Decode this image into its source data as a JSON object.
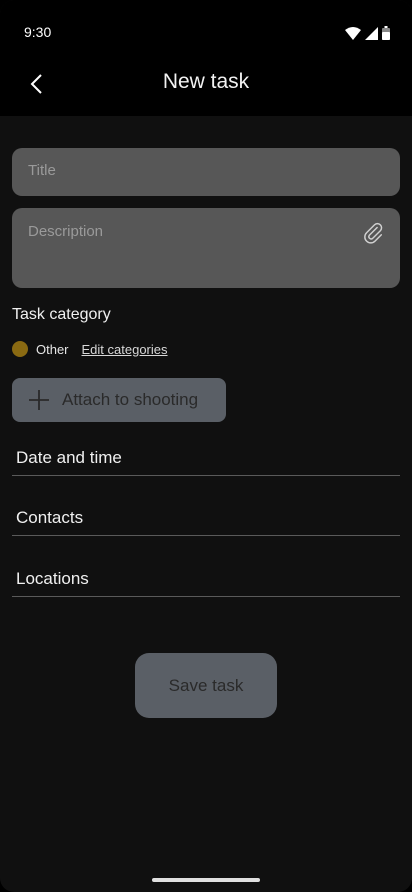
{
  "status_bar": {
    "time": "9:30"
  },
  "app_bar": {
    "title": "New task"
  },
  "form": {
    "title_placeholder": "Title",
    "title_value": "",
    "description_placeholder": "Description",
    "description_value": ""
  },
  "category": {
    "label": "Task category",
    "selected": "Other",
    "selected_color": "#8a6a12",
    "edit_link": "Edit categories"
  },
  "attach_button": {
    "label": "Attach to shooting",
    "icon": "plus-icon"
  },
  "rows": {
    "date_time": "Date and time",
    "contacts": "Contacts",
    "locations": "Locations"
  },
  "save_button": {
    "label": "Save task"
  },
  "colors": {
    "background": "#101010",
    "bar": "#000000",
    "field": "#575757",
    "button": "#5a5f66"
  }
}
